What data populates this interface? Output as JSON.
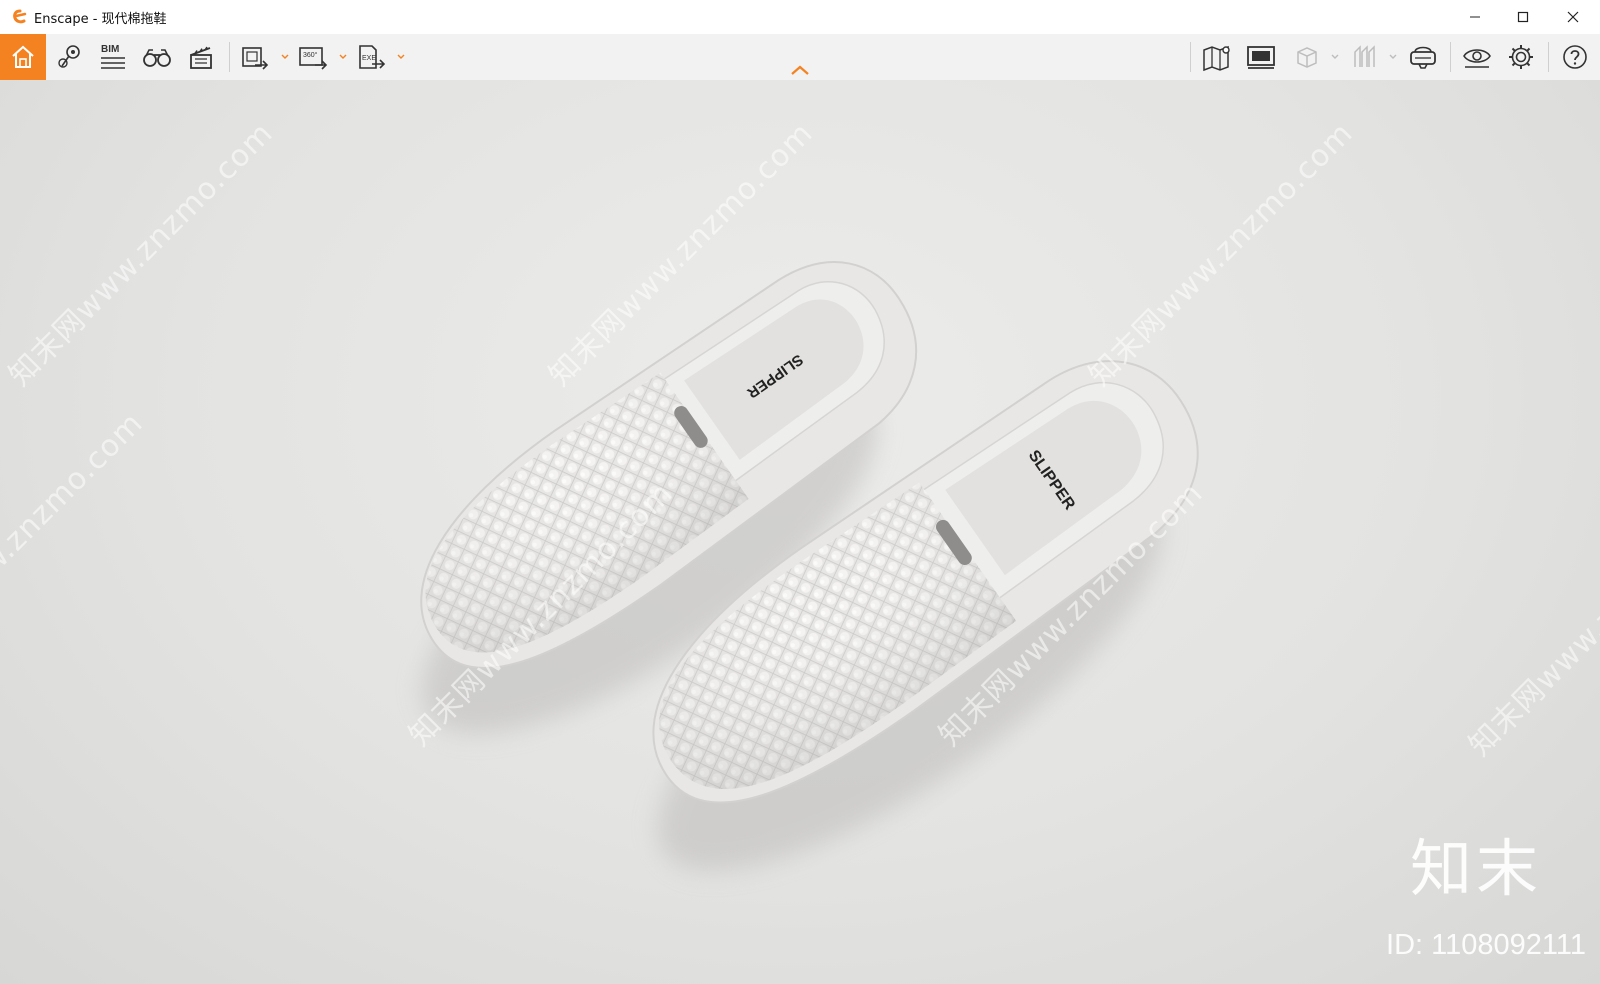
{
  "window": {
    "app_name": "Enscape",
    "title": "Enscape - 现代棉拖鞋",
    "controls": [
      "minimize-icon",
      "maximize-icon",
      "close-icon"
    ]
  },
  "toolbar": {
    "accent": "#f58220",
    "left_tools": [
      {
        "icon": "home-icon",
        "active": true
      },
      {
        "icon": "location-pin-icon"
      },
      {
        "icon": "bim-icon",
        "label": "BIM"
      },
      {
        "icon": "binoculars-icon"
      },
      {
        "icon": "clapperboard-icon"
      },
      {
        "icon": "export-image-icon",
        "dropdown": true
      },
      {
        "icon": "export-panorama-icon",
        "label": "360°",
        "dropdown": true
      },
      {
        "icon": "export-exe-icon",
        "label": "EXE",
        "dropdown": true
      }
    ],
    "right_tools": [
      {
        "icon": "map-icon"
      },
      {
        "icon": "billboard-icon"
      },
      {
        "icon": "cube-icon",
        "dropdown": true
      },
      {
        "icon": "section-icon",
        "dropdown": true
      },
      {
        "icon": "vr-headset-icon"
      },
      {
        "icon": "eye-icon"
      },
      {
        "icon": "gear-icon"
      },
      {
        "icon": "help-icon"
      }
    ]
  },
  "viewport": {
    "insole_text_left": "SLIPPER",
    "insole_text_right": "SLIPPER",
    "watermark_text": "知末网www.znzmo.com",
    "brand_mark": "知末",
    "id_mark": "ID: 1108092111"
  }
}
